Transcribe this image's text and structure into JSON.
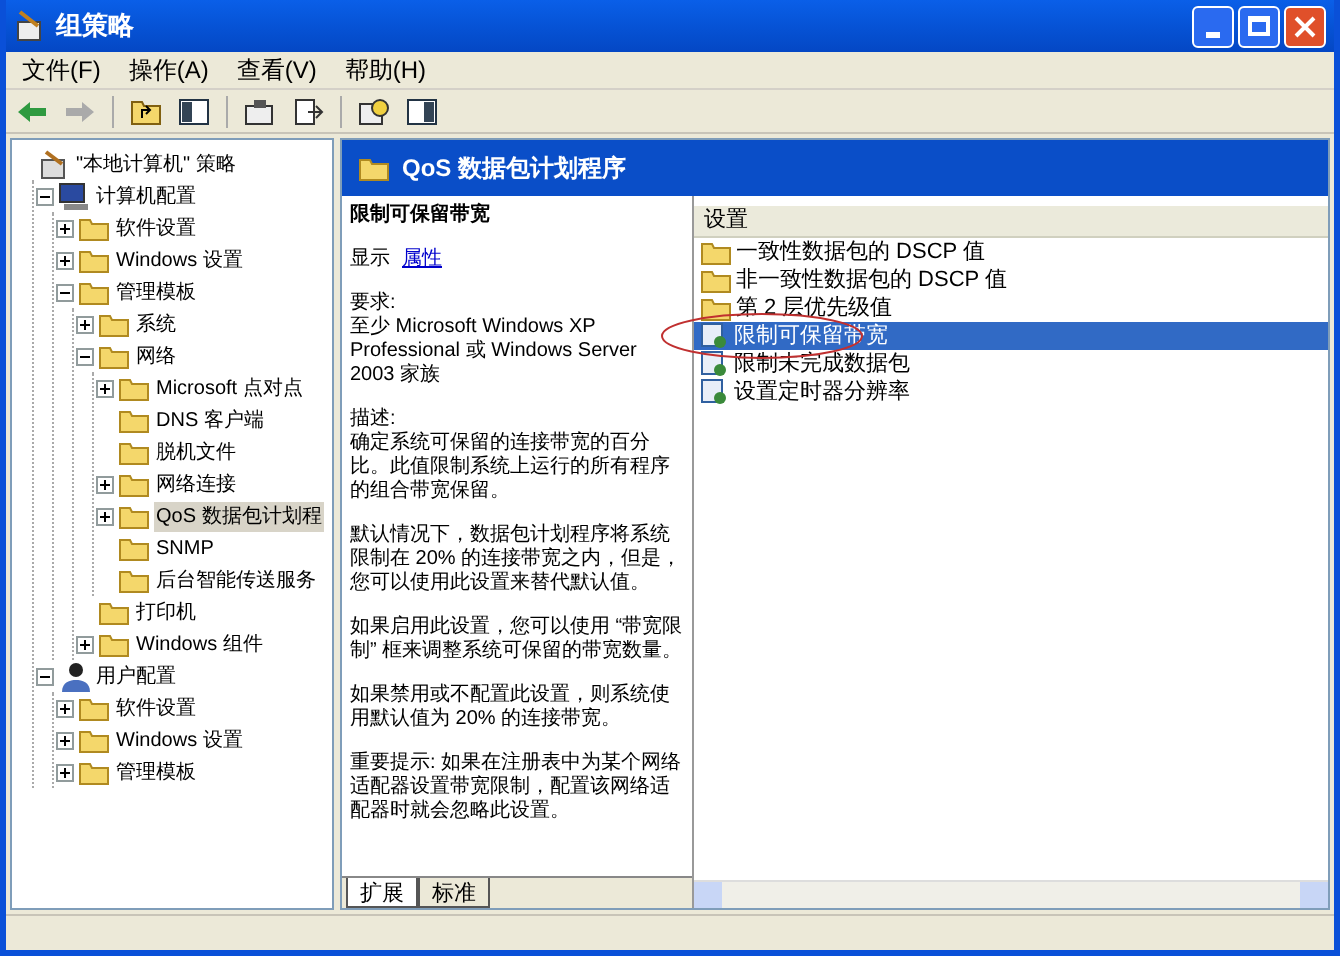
{
  "window": {
    "title": "组策略"
  },
  "menu": [
    "文件(F)",
    "操作(A)",
    "查看(V)",
    "帮助(H)"
  ],
  "tree": [
    {
      "label": "\"本地计算机\" 策略",
      "kind": "policy",
      "selected": false,
      "children": [
        {
          "label": "计算机配置",
          "kind": "computer",
          "expanded": true,
          "selected": false,
          "children": [
            {
              "label": "软件设置",
              "kind": "folder",
              "expanded": false,
              "selected": false
            },
            {
              "label": "Windows 设置",
              "kind": "folder",
              "expanded": false,
              "selected": false
            },
            {
              "label": "管理模板",
              "kind": "folder",
              "expanded": true,
              "selected": false,
              "children": [
                {
                  "label": "系统",
                  "kind": "folder",
                  "expanded": false,
                  "selected": false
                },
                {
                  "label": "网络",
                  "kind": "folder",
                  "expanded": true,
                  "selected": false,
                  "children": [
                    {
                      "label": "Microsoft 点对点",
                      "kind": "folder",
                      "expanded": false,
                      "selected": false
                    },
                    {
                      "label": "DNS 客户端",
                      "kind": "folder",
                      "selected": false
                    },
                    {
                      "label": "脱机文件",
                      "kind": "folder",
                      "selected": false
                    },
                    {
                      "label": "网络连接",
                      "kind": "folder",
                      "expanded": false,
                      "selected": false
                    },
                    {
                      "label": "QoS 数据包计划程",
                      "kind": "folder",
                      "expanded": false,
                      "selected": true
                    },
                    {
                      "label": "SNMP",
                      "kind": "folder",
                      "selected": false
                    },
                    {
                      "label": "后台智能传送服务",
                      "kind": "folder",
                      "selected": false
                    }
                  ]
                },
                {
                  "label": "打印机",
                  "kind": "folder",
                  "selected": false
                },
                {
                  "label": "Windows 组件",
                  "kind": "folder",
                  "expanded": false,
                  "selected": false
                }
              ]
            }
          ]
        },
        {
          "label": "用户配置",
          "kind": "user",
          "expanded": true,
          "selected": false,
          "children": [
            {
              "label": "软件设置",
              "kind": "folder",
              "expanded": false,
              "selected": false
            },
            {
              "label": "Windows 设置",
              "kind": "folder",
              "expanded": false,
              "selected": false
            },
            {
              "label": "管理模板",
              "kind": "folder",
              "expanded": false,
              "selected": false
            }
          ]
        }
      ]
    }
  ],
  "header": {
    "title": "QoS 数据包计划程序"
  },
  "description": {
    "title": "限制可保留带宽",
    "show_label": "显示",
    "show_link": "属性",
    "paragraphs": [
      "要求:\n至少 Microsoft Windows XP Professional 或 Windows Server 2003 家族",
      "描述:\n确定系统可保留的连接带宽的百分比。此值限制系统上运行的所有程序的组合带宽保留。",
      "默认情况下，数据包计划程序将系统限制在 20% 的连接带宽之内，但是，您可以使用此设置来替代默认值。",
      "如果启用此设置，您可以使用 “带宽限制” 框来调整系统可保留的带宽数量。",
      "如果禁用或不配置此设置，则系统使用默认值为 20% 的连接带宽。",
      "重要提示: 如果在注册表中为某个网络适配器设置带宽限制，配置该网络适配器时就会忽略此设置。"
    ]
  },
  "list": {
    "column": "设置",
    "rows": [
      {
        "label": "一致性数据包的 DSCP 值",
        "kind": "folder",
        "selected": false
      },
      {
        "label": "非一致性数据包的 DSCP 值",
        "kind": "folder",
        "selected": false
      },
      {
        "label": "第 2 层优先级值",
        "kind": "folder",
        "selected": false
      },
      {
        "label": "限制可保留带宽",
        "kind": "setting",
        "selected": true
      },
      {
        "label": "限制未完成数据包",
        "kind": "setting",
        "selected": false
      },
      {
        "label": "设置定时器分辨率",
        "kind": "setting",
        "selected": false
      }
    ]
  },
  "tabs": [
    {
      "label": "扩展",
      "selected": true
    },
    {
      "label": "标准",
      "selected": false
    }
  ]
}
